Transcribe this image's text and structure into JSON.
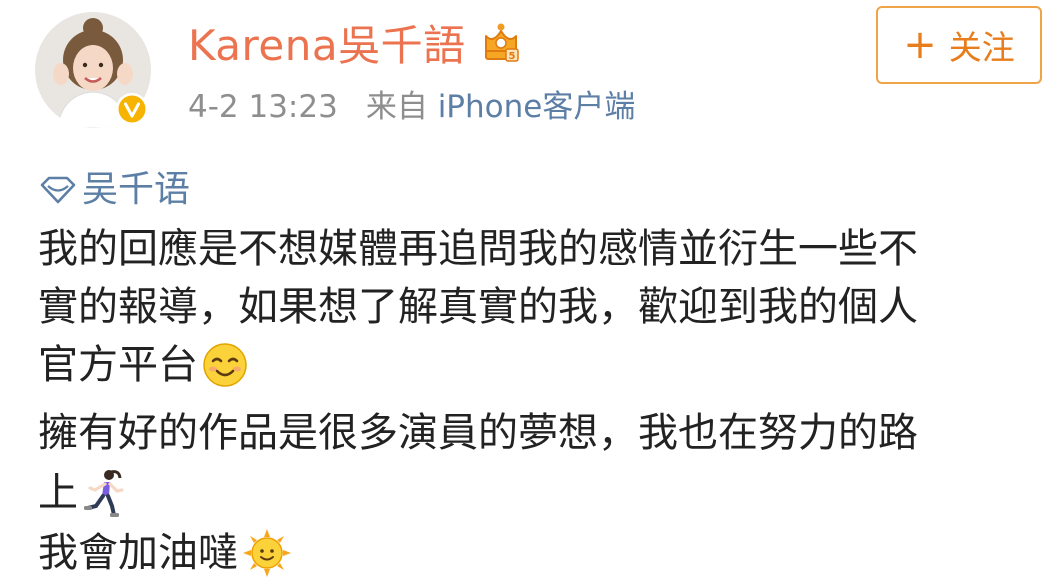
{
  "user": {
    "name": "Karena吳千語",
    "timestamp": "4-2 13:23",
    "source_prefix": "来自",
    "source_client": "iPhone客户端"
  },
  "follow_button": {
    "plus": "+",
    "label": "关注"
  },
  "topic": "吴千语",
  "post_lines": [
    "我的回應是不想媒體再追問我的感情並衍生一些不",
    "實的報導，如果想了解真實的我，歡迎到我的個人",
    "官方平台",
    "擁有好的作品是很多演員的夢想，我也在努力的路",
    "上",
    "我會加油噠"
  ],
  "emojis": {
    "line3": "smiling-relieved-face-icon",
    "line5": "running-woman-icon",
    "line6": "sun-with-face-icon"
  },
  "colors": {
    "username": "#eb7350",
    "link": "#5d7fa6",
    "meta": "#8e8e8e",
    "follow_border": "#f0a448",
    "follow_text": "#e87d1c",
    "text": "#222222",
    "verified": "#f6b400"
  }
}
